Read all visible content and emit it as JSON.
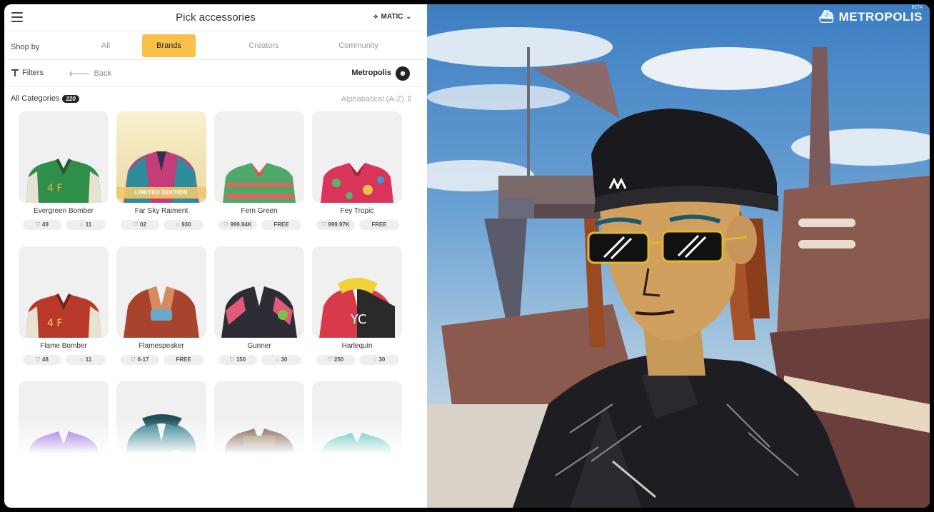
{
  "header": {
    "title": "Pick accessories",
    "currency": "MATIC"
  },
  "shop": {
    "label": "Shop by",
    "tabs": [
      {
        "label": "All",
        "active": false
      },
      {
        "label": "Brands",
        "active": true
      },
      {
        "label": "Creators",
        "active": false
      },
      {
        "label": "Community",
        "active": false
      }
    ],
    "accent": "#f7c14a"
  },
  "filters": {
    "filters_label": "Filters",
    "back_label": "Back",
    "brand": "Metropolis"
  },
  "category": {
    "label": "All Categories",
    "count": "220",
    "sort": "Alphabatical (A-Z)"
  },
  "items": [
    {
      "name": "Evergreen Bomber",
      "stat1": "49",
      "stat2": "11"
    },
    {
      "name": "Far Sky Raiment",
      "stat1": "02",
      "stat2": "930",
      "badge": "LIMITED EDITION"
    },
    {
      "name": "Fern Green",
      "stat1": "999.94K",
      "stat2": "FREE"
    },
    {
      "name": "Fey Tropic",
      "stat1": "999.97K",
      "stat2": "FREE"
    },
    {
      "name": "Flame Bomber",
      "stat1": "48",
      "stat2": "11"
    },
    {
      "name": "Flamespeaker",
      "stat1": "0-17",
      "stat2": "FREE"
    },
    {
      "name": "Gunner",
      "stat1": "150",
      "stat2": "30"
    },
    {
      "name": "Harlequin",
      "stat1": "250",
      "stat2": "30"
    }
  ],
  "right": {
    "logo": "METROPOLIS",
    "beta": "BETA"
  }
}
